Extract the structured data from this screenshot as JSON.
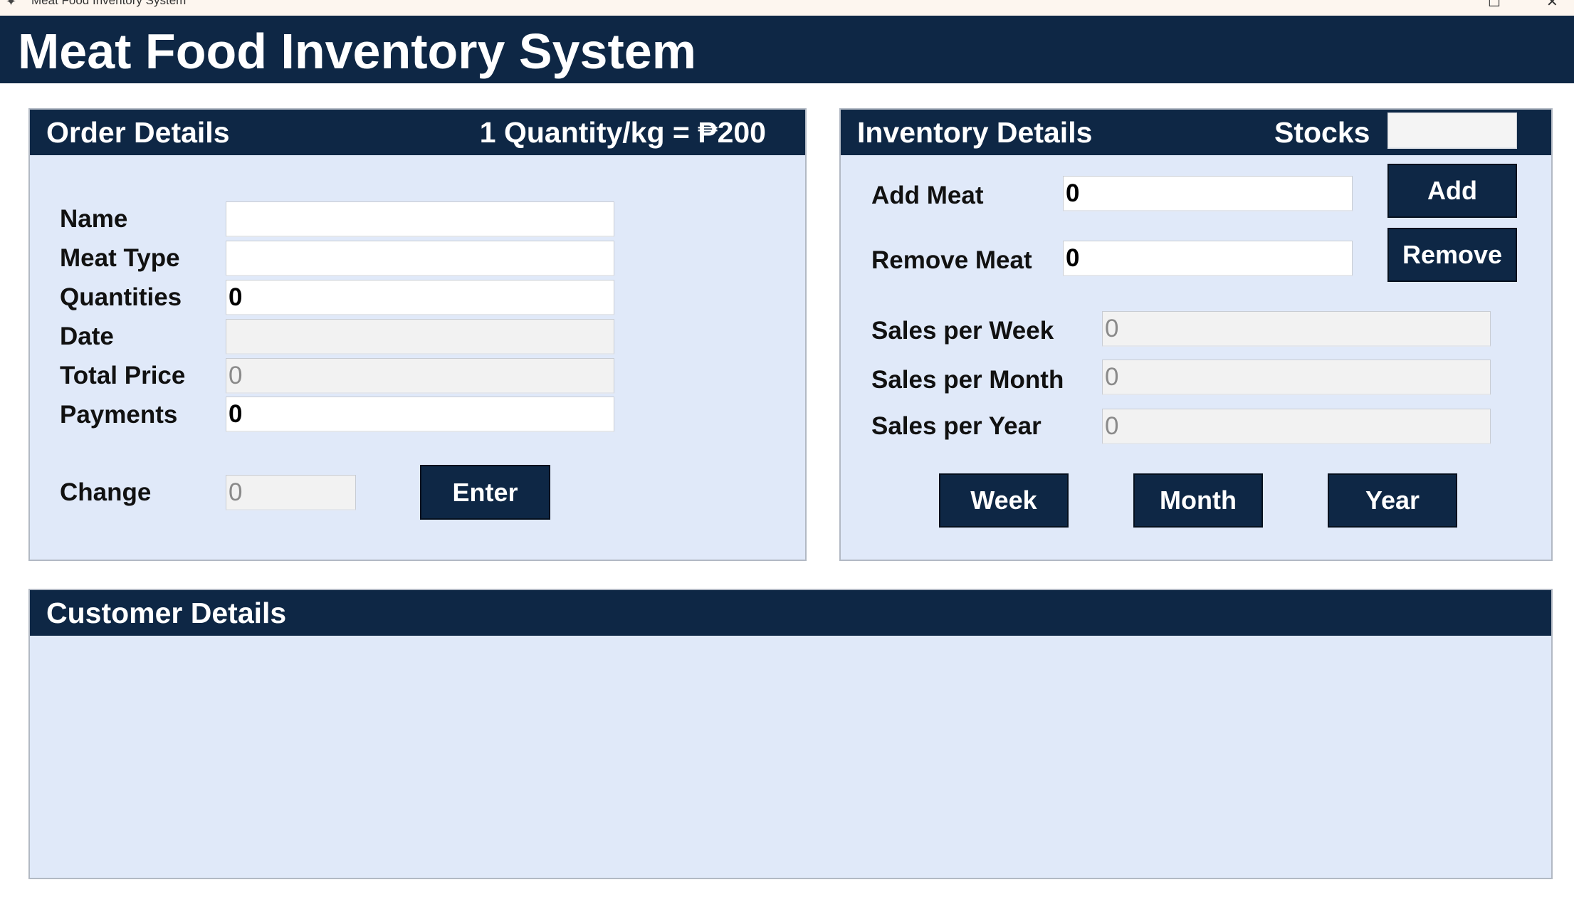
{
  "window": {
    "title": "Meat Food Inventory System"
  },
  "header": {
    "title": "Meat Food Inventory System"
  },
  "order": {
    "title": "Order Details",
    "price_note": "1 Quantity/kg = ₱200",
    "name_label": "Name",
    "name_value": "",
    "meat_type_label": "Meat Type",
    "meat_type_value": "",
    "quantities_label": "Quantities",
    "quantities_value": "0",
    "date_label": "Date",
    "date_value": "",
    "total_price_label": "Total Price",
    "total_price_value": "0",
    "payments_label": "Payments",
    "payments_value": "0",
    "change_label": "Change",
    "change_value": "0",
    "enter_label": "Enter"
  },
  "inventory": {
    "title": "Inventory Details",
    "stocks_label": "Stocks",
    "stocks_value": "",
    "add_meat_label": "Add Meat",
    "add_meat_value": "0",
    "add_button": "Add",
    "remove_meat_label": "Remove Meat",
    "remove_meat_value": "0",
    "remove_button": "Remove",
    "sales_week_label": "Sales per Week",
    "sales_week_value": "0",
    "sales_month_label": "Sales per Month",
    "sales_month_value": "0",
    "sales_year_label": "Sales per Year",
    "sales_year_value": "0",
    "week_button": "Week",
    "month_button": "Month",
    "year_button": "Year"
  },
  "customer": {
    "title": "Customer Details"
  },
  "theme": {
    "header_bg": "#0e2745",
    "panel_bg": "#e0e9f9",
    "readonly_bg": "#f2f2f2"
  },
  "icons": {
    "window_icon": "feather-icon",
    "maximize": "maximize-icon",
    "close": "close-icon"
  }
}
